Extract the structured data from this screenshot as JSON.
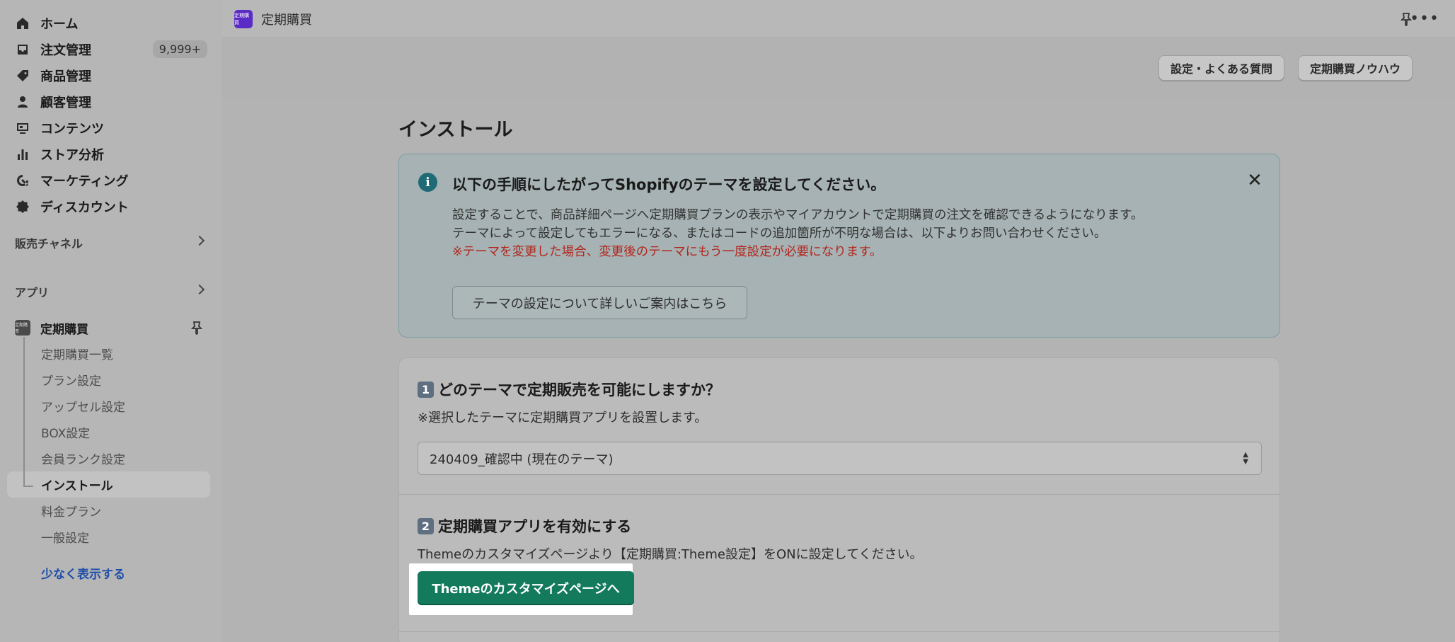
{
  "sidebar": {
    "nav": [
      {
        "label": "ホーム",
        "icon": "home-icon"
      },
      {
        "label": "注文管理",
        "icon": "inbox-icon",
        "badge": "9,999+"
      },
      {
        "label": "商品管理",
        "icon": "tag-icon"
      },
      {
        "label": "顧客管理",
        "icon": "person-icon"
      },
      {
        "label": "コンテンツ",
        "icon": "content-icon"
      },
      {
        "label": "ストア分析",
        "icon": "bar-chart-icon"
      },
      {
        "label": "マーケティング",
        "icon": "target-icon"
      },
      {
        "label": "ディスカウント",
        "icon": "discount-icon"
      }
    ],
    "sales_channel": "販売チャネル",
    "apps": "アプリ",
    "app_name": "定期購買",
    "app_logo_text": "定期購買",
    "sub_items": [
      {
        "label": "定期購買一覧"
      },
      {
        "label": "プラン設定"
      },
      {
        "label": "アップセル設定"
      },
      {
        "label": "BOX設定"
      },
      {
        "label": "会員ランク設定"
      },
      {
        "label": "インストール",
        "active": true
      },
      {
        "label": "料金プラン"
      },
      {
        "label": "一般設定"
      }
    ],
    "show_less": "少なく表示する"
  },
  "topbar": {
    "app_badge": "定期購買",
    "title": "定期購買",
    "more": "•••"
  },
  "header_buttons": {
    "settings_faq": "設定・よくある質問",
    "knowhow": "定期購買ノウハウ"
  },
  "page": {
    "title": "インストール"
  },
  "banner": {
    "title": "以下の手順にしたがってShopifyのテーマを設定してください。",
    "line1": "設定することで、商品詳細ページへ定期購買プランの表示やマイアカウントで定期購買の注文を確認できるようになります。",
    "line2": "テーマによって設定してもエラーになる、またはコードの追加箇所が不明な場合は、以下よりお問い合わせください。",
    "warning": "※テーマを変更した場合、変更後のテーマにもう一度設定が必要になります。",
    "guide_button": "テーマの設定について詳しいご案内はこちら",
    "close": "✕",
    "info": "i"
  },
  "step1": {
    "number": "1",
    "title": "どのテーマで定期販売を可能にしますか？",
    "desc": "※選択したテーマに定期購買アプリを設置します。",
    "selected_theme": "240409_確認中 (現在のテーマ)"
  },
  "step2": {
    "number": "2",
    "title": "定期購買アプリを有効にする",
    "desc": "Themeのカスタマイズページより【定期購買:Theme設定】をONに設定してください。",
    "button": "Themeのカスタマイズページへ"
  }
}
